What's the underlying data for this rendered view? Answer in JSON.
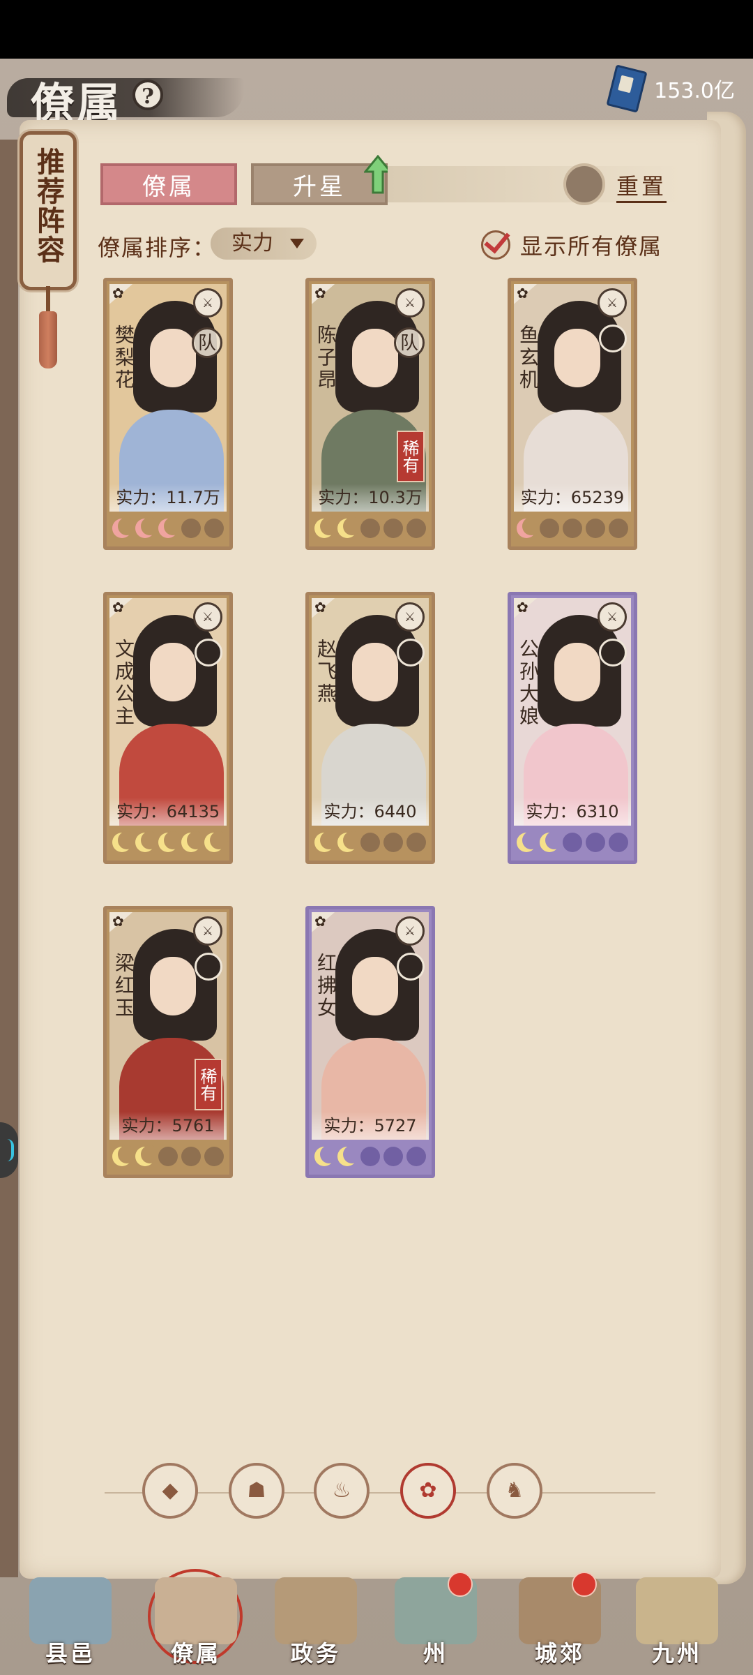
{
  "header": {
    "title": "僚属",
    "help_symbol": "?",
    "currency_value": "153.0亿",
    "currency_icon": "book-icon"
  },
  "side_tag": {
    "label": "推荐阵容"
  },
  "tabs": {
    "active": "僚属",
    "second": "升星",
    "reset_label": "重置"
  },
  "sort": {
    "label": "僚属排序：",
    "selected": "实力",
    "show_all_label": "显示所有僚属",
    "show_all_checked": true
  },
  "badges": {
    "team": "队",
    "rare": "稀有"
  },
  "cards": [
    {
      "name": "樊梨花",
      "power": "实力：11.7万",
      "frame": "gold",
      "team": true,
      "rare": false,
      "stars": 3,
      "star_color": "pink",
      "robe": "#9fb4d6",
      "bg": "#e2c79c"
    },
    {
      "name": "陈子昂",
      "power": "实力：10.3万",
      "frame": "gold",
      "team": true,
      "rare": true,
      "stars": 2,
      "star_color": "gold",
      "robe": "#6f7a62",
      "bg": "#cdbb9a"
    },
    {
      "name": "鱼玄机",
      "power": "实力：65239",
      "frame": "gold",
      "team": false,
      "rare": false,
      "stars": 1,
      "star_color": "pink",
      "robe": "#e7ddd6",
      "bg": "#dccbb4"
    },
    {
      "name": "文成公主",
      "power": "实力：64135",
      "frame": "gold",
      "team": false,
      "rare": false,
      "stars": 5,
      "star_color": "gold",
      "robe": "#c14a3e",
      "bg": "#e5cfae"
    },
    {
      "name": "赵飞燕",
      "power": "实力：6440",
      "frame": "gold",
      "team": false,
      "rare": false,
      "stars": 2,
      "star_color": "gold",
      "robe": "#d9d6cf",
      "bg": "#e0cfb0"
    },
    {
      "name": "公孙大娘",
      "power": "实力：6310",
      "frame": "purple",
      "team": false,
      "rare": false,
      "stars": 2,
      "star_color": "gold",
      "robe": "#f1c6cc",
      "bg": "#e8d8d6"
    },
    {
      "name": "梁红玉",
      "power": "实力：5761",
      "frame": "gold",
      "team": false,
      "rare": true,
      "stars": 2,
      "star_color": "gold",
      "robe": "#a83a30",
      "bg": "#d8c3a4"
    },
    {
      "name": "红拂女",
      "power": "实力：5727",
      "frame": "purple",
      "team": false,
      "rare": false,
      "stars": 2,
      "star_color": "gold",
      "robe": "#e8b7a6",
      "bg": "#dcc9c0"
    }
  ],
  "filters": [
    {
      "icon": "diamond-icon",
      "glyph": "◆",
      "active": false
    },
    {
      "icon": "helmet-icon",
      "glyph": "☗",
      "active": false
    },
    {
      "icon": "gourd-icon",
      "glyph": "♨",
      "active": false
    },
    {
      "icon": "fan-icon",
      "glyph": "✿",
      "active": true
    },
    {
      "icon": "lion-icon",
      "glyph": "♞",
      "active": false
    }
  ],
  "nav": [
    {
      "label": "县邑",
      "dot": false,
      "active": false,
      "color": "#8aa3b0"
    },
    {
      "label": "僚属",
      "dot": false,
      "active": true,
      "color": "#c9b094"
    },
    {
      "label": "政务",
      "dot": false,
      "active": false,
      "color": "#b59a78"
    },
    {
      "label": "州",
      "dot": true,
      "active": false,
      "color": "#8ea59c"
    },
    {
      "label": "城郊",
      "dot": true,
      "active": false,
      "color": "#a88a6a"
    },
    {
      "label": "九州",
      "dot": false,
      "active": false,
      "color": "#c9b48c"
    }
  ]
}
